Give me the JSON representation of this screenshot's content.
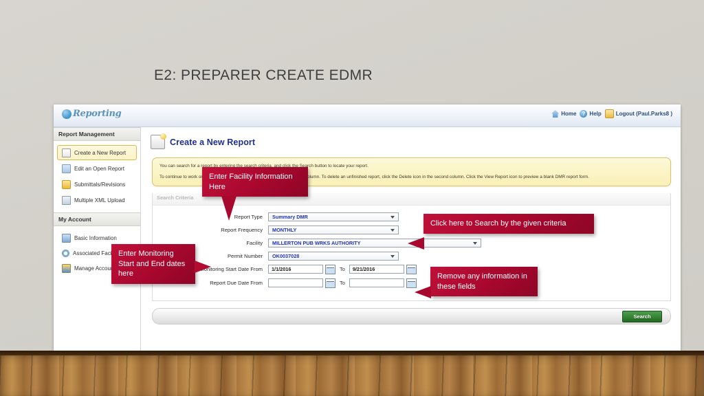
{
  "slide": {
    "title": "E2: PREPARER CREATE EDMR"
  },
  "app": {
    "logo": {
      "mark": "G",
      "word": "Reporting"
    },
    "topnav": [
      {
        "icon": "home-icon",
        "label": "Home"
      },
      {
        "icon": "help-icon",
        "label": "Help"
      },
      {
        "icon": "logout-icon",
        "label": "Logout (Paul.Parks8 )"
      }
    ],
    "sidebar": {
      "groups": [
        {
          "heading": "Report Management",
          "items": [
            {
              "label": "Create a New Report",
              "icon": "document-icon",
              "active": true
            },
            {
              "label": "Edit an Open Report",
              "icon": "edit-document-icon",
              "active": false
            },
            {
              "label": "Submittals/Revisions",
              "icon": "folder-icon",
              "active": false
            },
            {
              "label": "Multiple XML Upload",
              "icon": "xml-file-icon",
              "active": false
            }
          ]
        },
        {
          "heading": "My Account",
          "items": [
            {
              "label": "Basic Information",
              "icon": "user-card-icon",
              "active": false
            },
            {
              "label": "Associated Facilities",
              "icon": "refresh-icon",
              "active": false
            },
            {
              "label": "Manage Accounts",
              "icon": "accounts-icon",
              "active": false
            }
          ]
        }
      ]
    },
    "page": {
      "title": "Create a New Report",
      "icon": "new-report-icon",
      "notice": {
        "line1": "You can search for a report by entering the search criteria, and click the Search button to locate your report.",
        "line2": "To continue to work on an unfinished report, click the link shown in the first column. To delete an unfinished report, click the Delete icon in the second column. Click the View Report icon to preview a blank DMR report form."
      },
      "criteria": {
        "heading": "Search Criteria",
        "fields": [
          {
            "label": "Report Type",
            "value": "Summary DMR",
            "type": "select",
            "width": "w-med"
          },
          {
            "label": "Report Frequency",
            "value": "MONTHLY",
            "type": "select",
            "width": "w-med"
          },
          {
            "label": "Facility",
            "value": "MILLERTON PUB WRKS AUTHORITY",
            "type": "select",
            "width": "w-wide"
          },
          {
            "label": "Permit Number",
            "value": "OK0037028",
            "type": "select",
            "width": "w-med"
          }
        ],
        "date_rows": [
          {
            "label": "Monitoring Start Date From",
            "from": "1/1/2016",
            "separator": "To",
            "to": "9/21/2016"
          },
          {
            "label": "Report Due Date From",
            "from": "",
            "separator": "To",
            "to": ""
          }
        ]
      },
      "search_button": "Search"
    }
  },
  "callouts": {
    "facility": "Enter Facility Information Here",
    "search": "Click here to Search by the given criteria",
    "dates": "Enter Monitoring Start and End dates here",
    "remove": "Remove any information in these fields"
  },
  "colors": {
    "callout_red": "#a8072e",
    "accent_blue": "#1f2f8f",
    "field_value_blue": "#2035b5",
    "search_green": "#1f6b1f",
    "notice_yellow": "#faf0b6"
  }
}
